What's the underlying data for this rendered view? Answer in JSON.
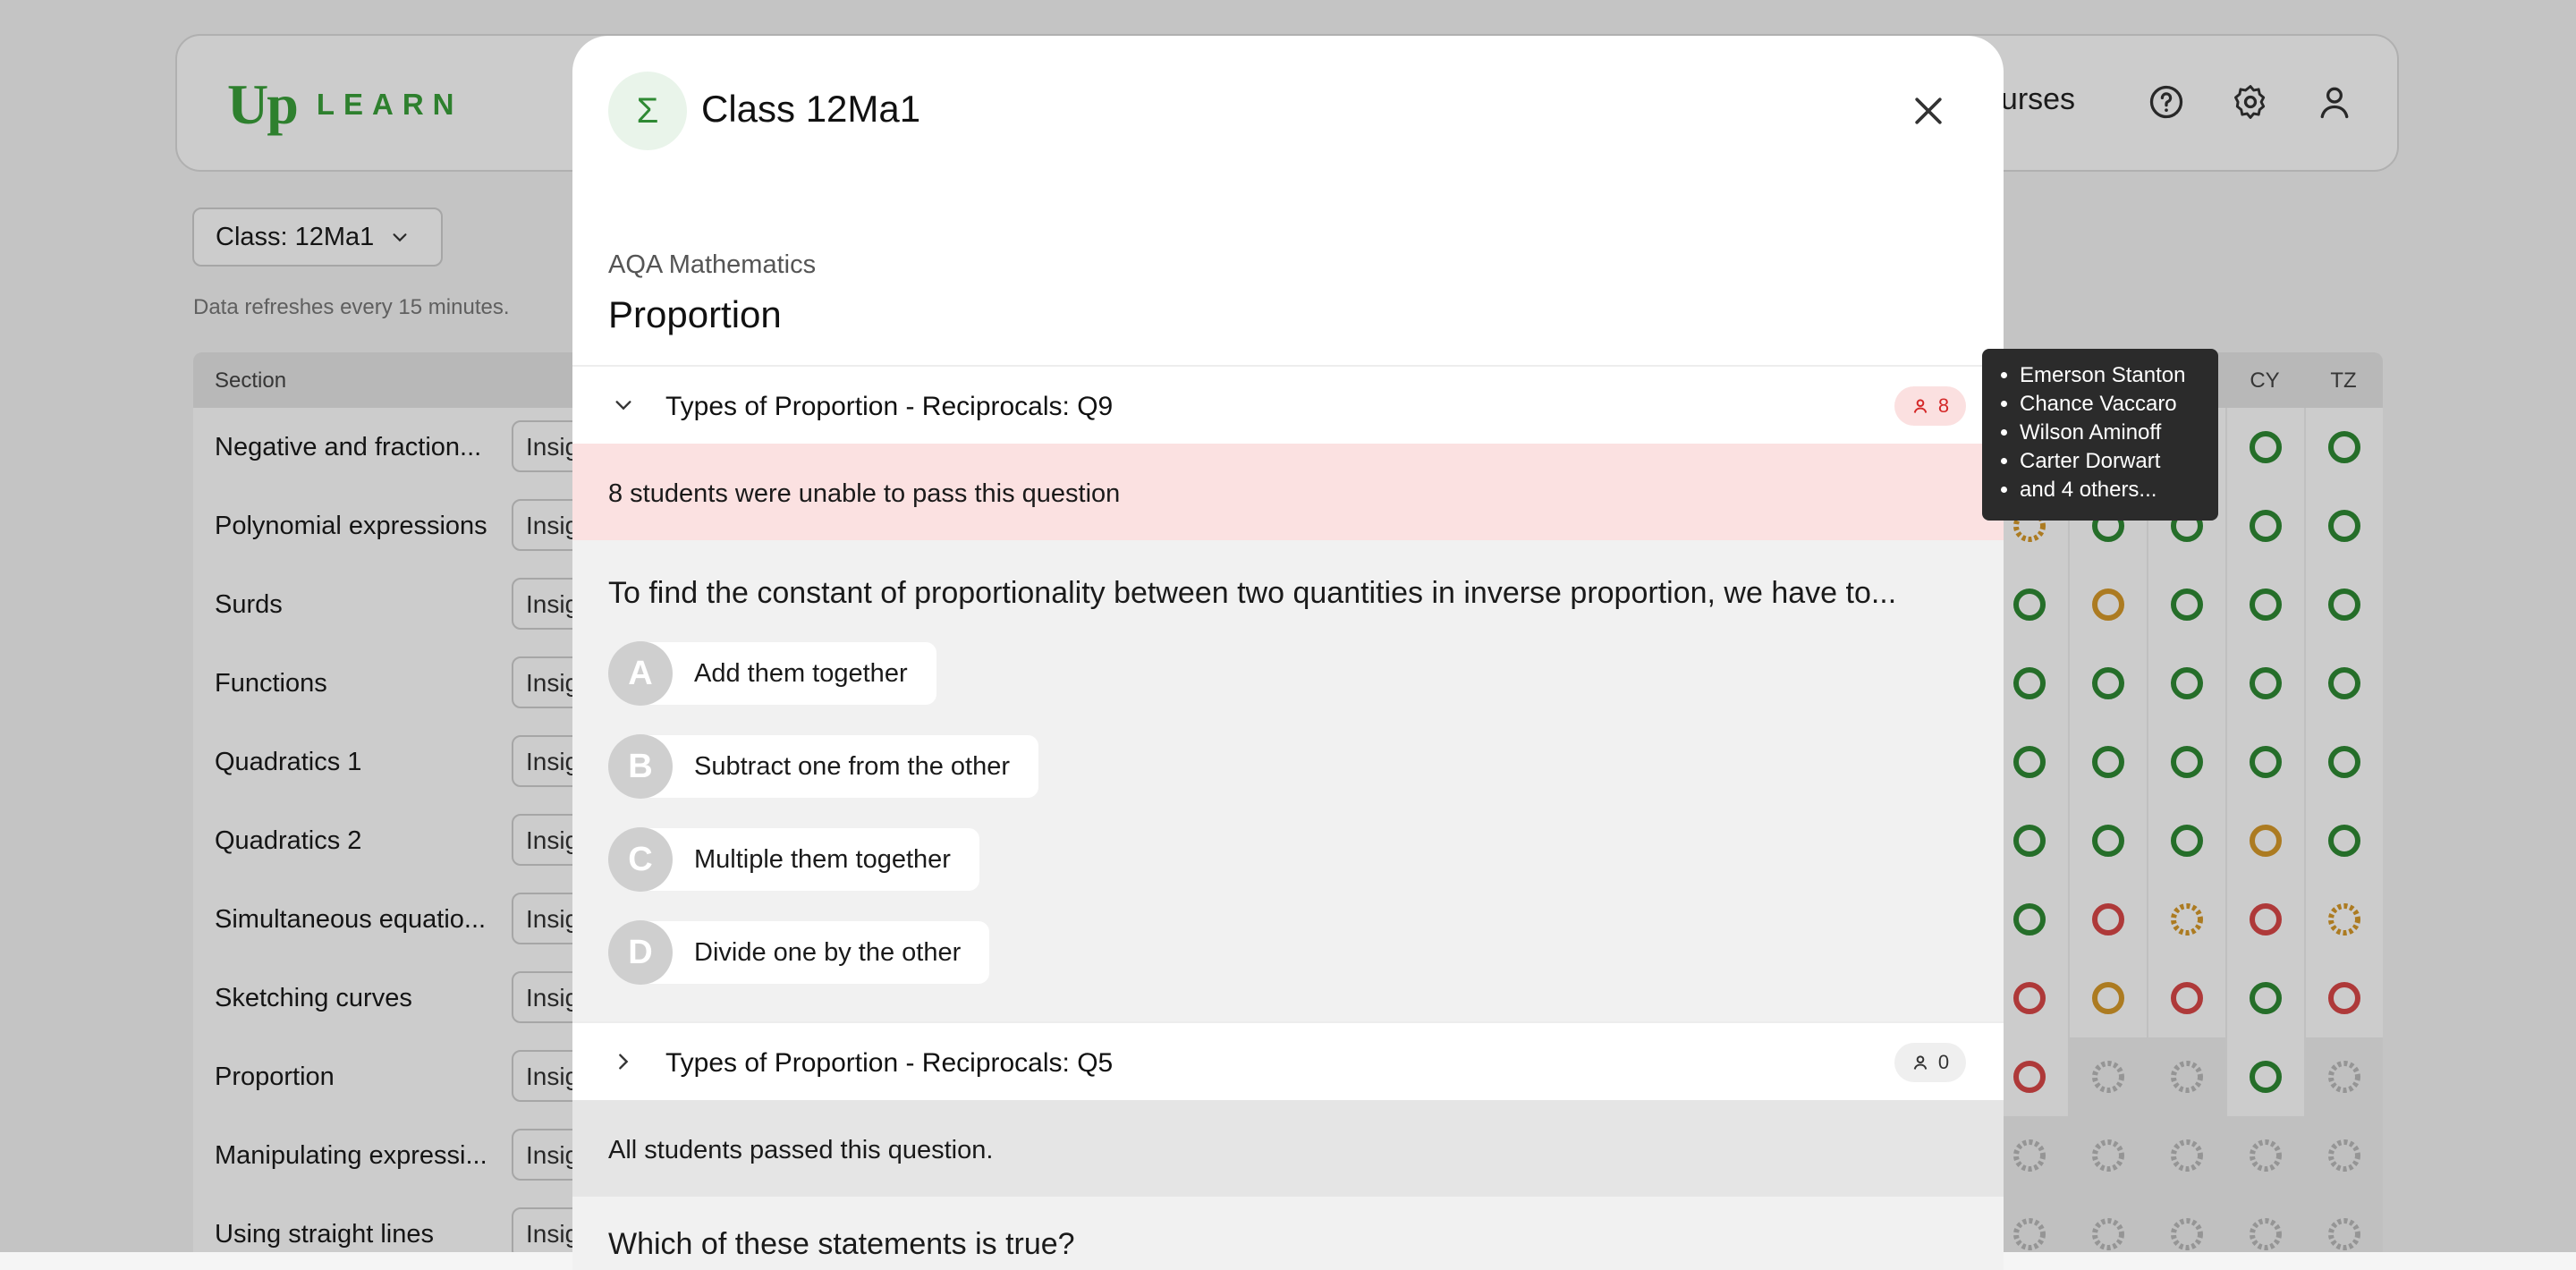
{
  "brand": {
    "logo_up": "Up",
    "logo_learn": "LEARN",
    "primary_color": "#3aa03a"
  },
  "nav": {
    "courses_label": "ourses",
    "icons": [
      "help-icon",
      "gear-icon",
      "user-icon"
    ]
  },
  "class_select": {
    "label": "Class: 12Ma1"
  },
  "refresh_note": "Data refreshes every 15 minutes.",
  "table": {
    "section_header": "Section",
    "visible_columns": [
      "CY",
      "TZ"
    ],
    "insights_label": "Insights",
    "rows": [
      "Negative and fraction...",
      "Polynomial expressions",
      "Surds",
      "Functions",
      "Quadratics 1",
      "Quadratics 2",
      "Simultaneous equatio...",
      "Sketching curves",
      "Proportion",
      "Manipulating expressi...",
      "Using straight lines"
    ]
  },
  "modal": {
    "icon": "Σ",
    "title": "Class 12Ma1",
    "course": "AQA Mathematics",
    "topic": "Proportion",
    "questions": [
      {
        "title": "Types of Proportion - Reciprocals: Q9",
        "count": "8",
        "expanded": true,
        "banner": "8 students were unable to pass this question",
        "prompt": "To find the constant of proportionality between two quantities in inverse proportion, we have to...",
        "options": [
          {
            "letter": "A",
            "text": "Add them together"
          },
          {
            "letter": "B",
            "text": "Subtract one from the other"
          },
          {
            "letter": "C",
            "text": "Multiple them together"
          },
          {
            "letter": "D",
            "text": "Divide one by the other"
          }
        ]
      },
      {
        "title": "Types of Proportion - Reciprocals: Q5",
        "count": "0",
        "expanded": false,
        "banner": "All students passed this question.",
        "prompt": "Which of these statements is true?"
      }
    ]
  },
  "tooltip": {
    "students": [
      "Emerson Stanton",
      "Chance Vaccaro",
      "Wilson Aminoff",
      "Carter Dorwart",
      "and 4 others..."
    ]
  },
  "colors": {
    "fail": "#d42828",
    "fail_bg": "#fbe0e0",
    "pass": "#2f8a34",
    "partial": "#d89a2a"
  }
}
